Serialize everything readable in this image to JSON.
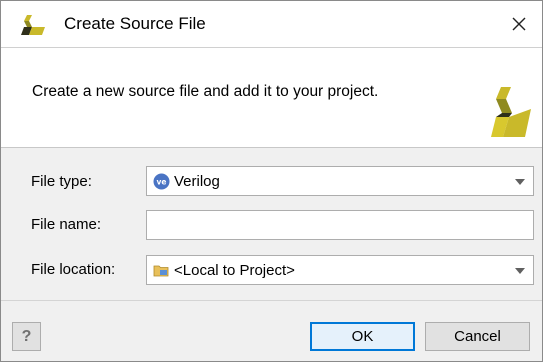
{
  "window": {
    "title": "Create Source File",
    "close_symbol": "✕"
  },
  "header": {
    "description": "Create a new source file and add it to your project."
  },
  "form": {
    "file_type": {
      "label": "File type:",
      "value": "Verilog",
      "icon": "verilog-file-icon"
    },
    "file_name": {
      "label": "File name:",
      "value": ""
    },
    "file_location": {
      "label": "File location:",
      "value": "<Local to Project>",
      "icon": "folder-icon"
    }
  },
  "footer": {
    "help_label": "?",
    "ok_label": "OK",
    "cancel_label": "Cancel"
  },
  "colors": {
    "logo_yellow": "#c9b92a",
    "logo_dark": "#2f2f1a",
    "ok_border": "#0078d7",
    "verilog_icon": "#4a74c4",
    "folder_yellow": "#e8c05a"
  }
}
